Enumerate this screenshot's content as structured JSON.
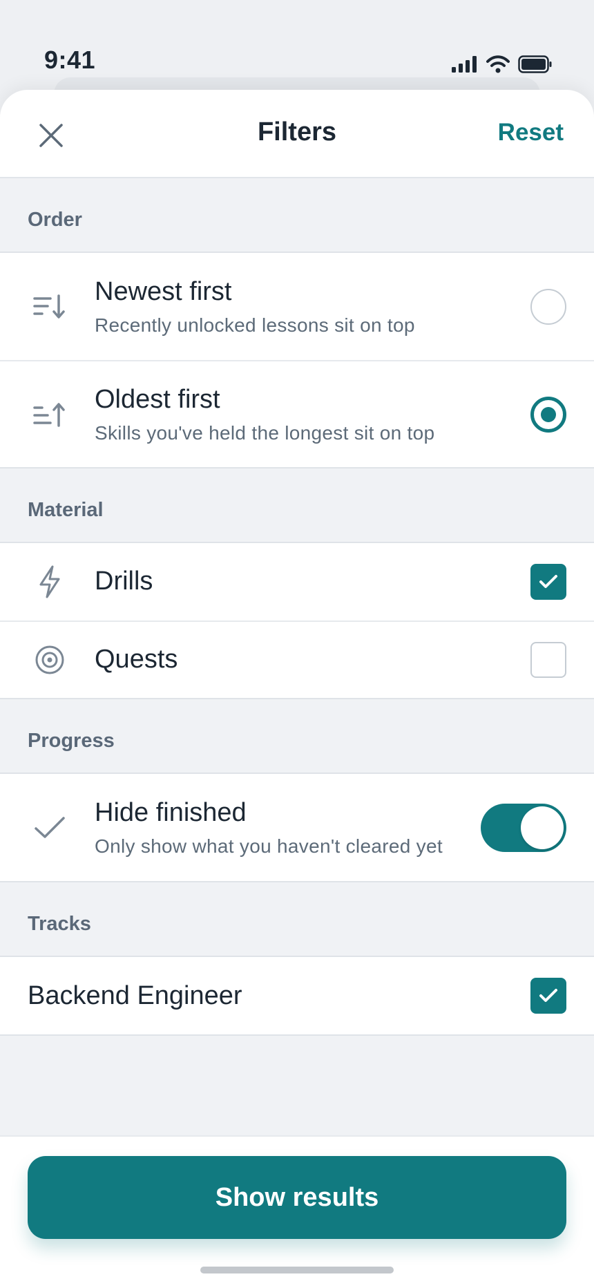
{
  "status_bar": {
    "time": "9:41"
  },
  "header": {
    "title": "Filters",
    "reset_label": "Reset"
  },
  "sections": {
    "order": {
      "label": "Order",
      "options": [
        {
          "title": "Newest first",
          "subtitle": "Recently unlocked lessons sit on top",
          "selected": false,
          "icon": "sort-descending-icon"
        },
        {
          "title": "Oldest first",
          "subtitle": "Skills you've held the longest sit on top",
          "selected": true,
          "icon": "sort-ascending-icon"
        }
      ]
    },
    "material": {
      "label": "Material",
      "options": [
        {
          "title": "Drills",
          "checked": true,
          "icon": "lightning-icon"
        },
        {
          "title": "Quests",
          "checked": false,
          "icon": "target-icon"
        }
      ]
    },
    "progress": {
      "label": "Progress",
      "hide_finished": {
        "title": "Hide finished",
        "subtitle": "Only show what you haven't cleared yet",
        "enabled": true,
        "icon": "check-icon"
      }
    },
    "tracks": {
      "label": "Tracks",
      "options": [
        {
          "title": "Backend Engineer",
          "checked": true
        }
      ]
    }
  },
  "footer": {
    "button_label": "Show results"
  },
  "colors": {
    "accent": "#117a80",
    "text": "#1c2733",
    "muted": "#5c6a78",
    "background": "#f0f2f5"
  }
}
